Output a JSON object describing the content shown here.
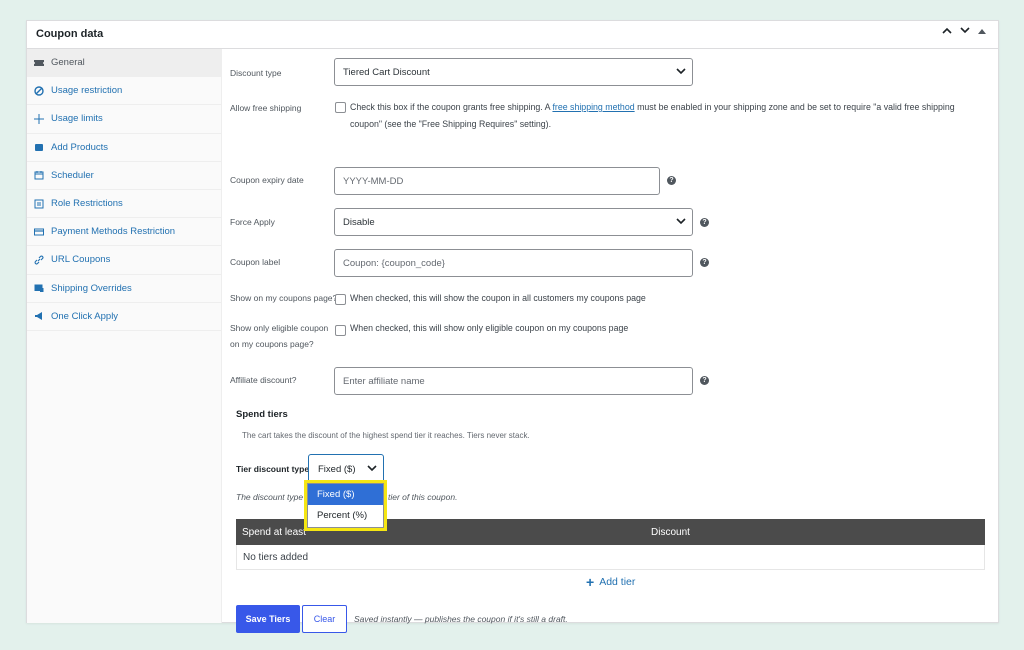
{
  "panel": {
    "title": "Coupon data"
  },
  "sidebar": {
    "items": [
      {
        "label": "General",
        "icon": "ticket-icon"
      },
      {
        "label": "Usage restriction",
        "icon": "prohibited-icon"
      },
      {
        "label": "Usage limits",
        "icon": "plus-icon"
      },
      {
        "label": "Add Products",
        "icon": "cart-icon"
      },
      {
        "label": "Scheduler",
        "icon": "calendar-icon"
      },
      {
        "label": "Role Restrictions",
        "icon": "role-icon"
      },
      {
        "label": "Payment Methods Restriction",
        "icon": "credit-card-icon"
      },
      {
        "label": "URL Coupons",
        "icon": "link-icon"
      },
      {
        "label": "Shipping Overrides",
        "icon": "shipping-icon"
      },
      {
        "label": "One Click Apply",
        "icon": "megaphone-icon"
      }
    ]
  },
  "form": {
    "discount_type": {
      "label": "Discount type",
      "value": "Tiered Cart Discount"
    },
    "free_shipping": {
      "label": "Allow free shipping",
      "text_before": "Check this box if the coupon grants free shipping. A ",
      "link": "free shipping method",
      "text_after": " must be enabled in your shipping zone and be set to require \"a valid free shipping coupon\" (see the \"Free Shipping Requires\" setting)."
    },
    "expiry": {
      "label": "Coupon expiry date",
      "placeholder": "YYYY-MM-DD"
    },
    "force_apply": {
      "label": "Force Apply",
      "value": "Disable"
    },
    "coupon_label": {
      "label": "Coupon label",
      "placeholder": "Coupon: {coupon_code}"
    },
    "show_my_coupons": {
      "label": "Show on my coupons page?",
      "desc": "When checked, this will show the coupon in all customers my coupons page"
    },
    "show_eligible": {
      "label_line1": "Show only eligible coupon",
      "label_line2": "on my coupons page?",
      "desc": "When checked, this will show only eligible coupon on my coupons page"
    },
    "affiliate": {
      "label": "Affiliate discount?",
      "placeholder": "Enter affiliate name"
    }
  },
  "tiers": {
    "title": "Spend tiers",
    "subtitle": "The cart takes the discount of the highest spend tier it reaches. Tiers never stack.",
    "type_label": "Tier discount type",
    "type_value": "Fixed ($)",
    "note_start": "The discount type",
    "note_end": "tier of this coupon.",
    "options": [
      "Fixed ($)",
      "Percent (%)"
    ],
    "columns": [
      "Spend at least",
      "Discount"
    ],
    "empty": "No tiers added",
    "add_label": "Add tier",
    "save_label": "Save Tiers",
    "clear_label": "Clear",
    "save_note": "Saved instantly — publishes the coupon if it's still a draft."
  },
  "colors": {
    "accent": "#3858e9",
    "link": "#2271b1",
    "highlight": "#f5e613",
    "selected_option": "#2f6fd6"
  }
}
